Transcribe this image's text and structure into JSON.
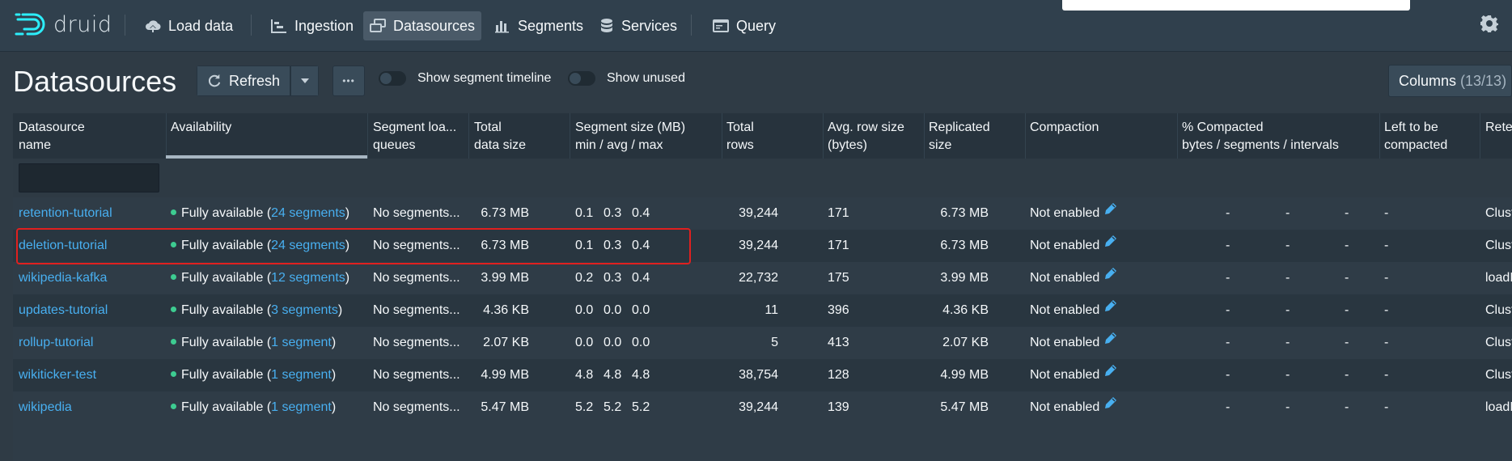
{
  "nav": {
    "logo_text": "druid",
    "items": [
      {
        "label": "Load data",
        "icon": "cloud-upload-icon"
      },
      {
        "label": "Ingestion",
        "icon": "gantt-chart-icon"
      },
      {
        "label": "Datasources",
        "icon": "multi-select-icon",
        "active": true
      },
      {
        "label": "Segments",
        "icon": "stacked-chart-icon"
      },
      {
        "label": "Services",
        "icon": "database-icon"
      },
      {
        "label": "Query",
        "icon": "application-icon"
      }
    ],
    "settings_icon": "gear-icon"
  },
  "toolbar": {
    "title": "Datasources",
    "refresh_label": "Refresh",
    "more_label": "•••",
    "switch_timeline": "Show segment timeline",
    "switch_unused": "Show unused",
    "columns_label": "Columns",
    "columns_count": "(13/13)"
  },
  "table": {
    "headers": [
      [
        "Datasource",
        "name"
      ],
      [
        "Availability",
        ""
      ],
      [
        "Segment loa...",
        "queues"
      ],
      [
        "Total",
        "data size"
      ],
      [
        "Segment size (MB)",
        "min / avg / max"
      ],
      [
        "Total",
        "rows"
      ],
      [
        "Avg. row size",
        "(bytes)"
      ],
      [
        "Replicated",
        "size"
      ],
      [
        "Compaction",
        ""
      ],
      [
        "% Compacted",
        "bytes / segments / intervals"
      ],
      [
        "Left to be",
        "compacted"
      ],
      [
        "Rete",
        ""
      ]
    ],
    "rows": [
      {
        "name": "retention-tutorial",
        "avail_pre": "Fully available (",
        "avail_link": "24 segments",
        "avail_post": ")",
        "queues": "No segments...",
        "size": "6.73 MB",
        "min": "0.1",
        "avg": "0.3",
        "max": "0.4",
        "rows": "39,244",
        "avg_row": "171",
        "replicated": "6.73 MB",
        "compaction": "Not enabled",
        "pct1": "-",
        "pct2": "-",
        "pct3": "-",
        "left": "-",
        "retention": "Clust"
      },
      {
        "name": "deletion-tutorial",
        "avail_pre": "Fully available (",
        "avail_link": "24 segments",
        "avail_post": ")",
        "queues": "No segments...",
        "size": "6.73 MB",
        "min": "0.1",
        "avg": "0.3",
        "max": "0.4",
        "rows": "39,244",
        "avg_row": "171",
        "replicated": "6.73 MB",
        "compaction": "Not enabled",
        "pct1": "-",
        "pct2": "-",
        "pct3": "-",
        "left": "-",
        "retention": "Clust"
      },
      {
        "name": "wikipedia-kafka",
        "avail_pre": "Fully available (",
        "avail_link": "12 segments",
        "avail_post": ")",
        "queues": "No segments...",
        "size": "3.99 MB",
        "min": "0.2",
        "avg": "0.3",
        "max": "0.4",
        "rows": "22,732",
        "avg_row": "175",
        "replicated": "3.99 MB",
        "compaction": "Not enabled",
        "pct1": "-",
        "pct2": "-",
        "pct3": "-",
        "left": "-",
        "retention": "loadI"
      },
      {
        "name": "updates-tutorial",
        "avail_pre": "Fully available (",
        "avail_link": "3 segments",
        "avail_post": ")",
        "queues": "No segments...",
        "size": "4.36 KB",
        "min": "0.0",
        "avg": "0.0",
        "max": "0.0",
        "rows": "11",
        "avg_row": "396",
        "replicated": "4.36 KB",
        "compaction": "Not enabled",
        "pct1": "-",
        "pct2": "-",
        "pct3": "-",
        "left": "-",
        "retention": "Clust"
      },
      {
        "name": "rollup-tutorial",
        "avail_pre": "Fully available (",
        "avail_link": "1 segment",
        "avail_post": ")",
        "queues": "No segments...",
        "size": "2.07 KB",
        "min": "0.0",
        "avg": "0.0",
        "max": "0.0",
        "rows": "5",
        "avg_row": "413",
        "replicated": "2.07 KB",
        "compaction": "Not enabled",
        "pct1": "-",
        "pct2": "-",
        "pct3": "-",
        "left": "-",
        "retention": "Clust"
      },
      {
        "name": "wikiticker-test",
        "avail_pre": "Fully available (",
        "avail_link": "1 segment",
        "avail_post": ")",
        "queues": "No segments...",
        "size": "4.99 MB",
        "min": "4.8",
        "avg": "4.8",
        "max": "4.8",
        "rows": "38,754",
        "avg_row": "128",
        "replicated": "4.99 MB",
        "compaction": "Not enabled",
        "pct1": "-",
        "pct2": "-",
        "pct3": "-",
        "left": "-",
        "retention": "Clust"
      },
      {
        "name": "wikipedia",
        "avail_pre": "Fully available (",
        "avail_link": "1 segment",
        "avail_post": ")",
        "queues": "No segments...",
        "size": "5.47 MB",
        "min": "5.2",
        "avg": "5.2",
        "max": "5.2",
        "rows": "39,244",
        "avg_row": "139",
        "replicated": "5.47 MB",
        "compaction": "Not enabled",
        "pct1": "-",
        "pct2": "-",
        "pct3": "-",
        "left": "-",
        "retention": "loadI"
      }
    ]
  },
  "colors": {
    "accent_link": "#48aff0",
    "available_dot": "#3dcc91",
    "highlight_box": "#e0201f"
  }
}
